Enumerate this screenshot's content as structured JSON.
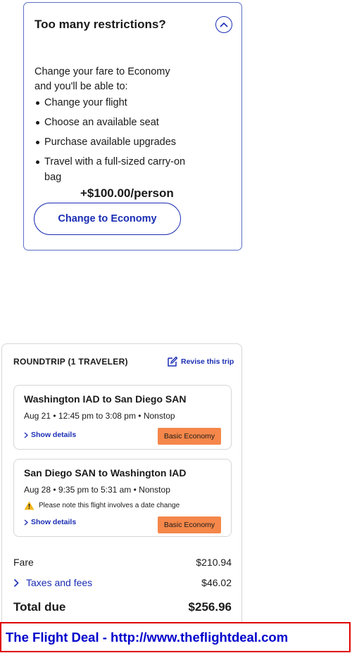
{
  "upsell": {
    "title": "Too many restrictions?",
    "intro": "Change your fare to Economy and you'll be able to:",
    "benefits": [
      "Change your flight",
      "Choose an available seat",
      "Purchase available upgrades",
      "Travel with a full-sized carry-on bag"
    ],
    "price": "+$100.00/person",
    "button_label": "Change to Economy",
    "collapse_icon": "chevron-up-icon"
  },
  "summary": {
    "heading": "ROUNDTRIP (1 TRAVELER)",
    "revise_label": "Revise this trip",
    "flights": [
      {
        "route": "Washington IAD to San Diego SAN",
        "times": "Aug 21 • 12:45 pm to 3:08 pm • Nonstop",
        "details_label": "Show details",
        "fare_badge": "Basic Economy"
      },
      {
        "route": "San Diego SAN to Washington IAD",
        "times": "Aug 28 • 9:35 pm to 5:31 am • Nonstop",
        "warning": "Please note this flight involves a date change",
        "details_label": "Show details",
        "fare_badge": "Basic Economy"
      }
    ],
    "fare_label": "Fare",
    "fare_value": "$210.94",
    "taxes_label": "Taxes and fees",
    "taxes_value": "$46.02",
    "total_label": "Total due",
    "total_value": "$256.96"
  },
  "watermark": {
    "text": "The Flight Deal - http://www.theflightdeal.com"
  },
  "colors": {
    "accent": "#1a2db3",
    "badge": "#f5874a",
    "watermark_border": "#e00000",
    "watermark_text": "#0000cc"
  }
}
